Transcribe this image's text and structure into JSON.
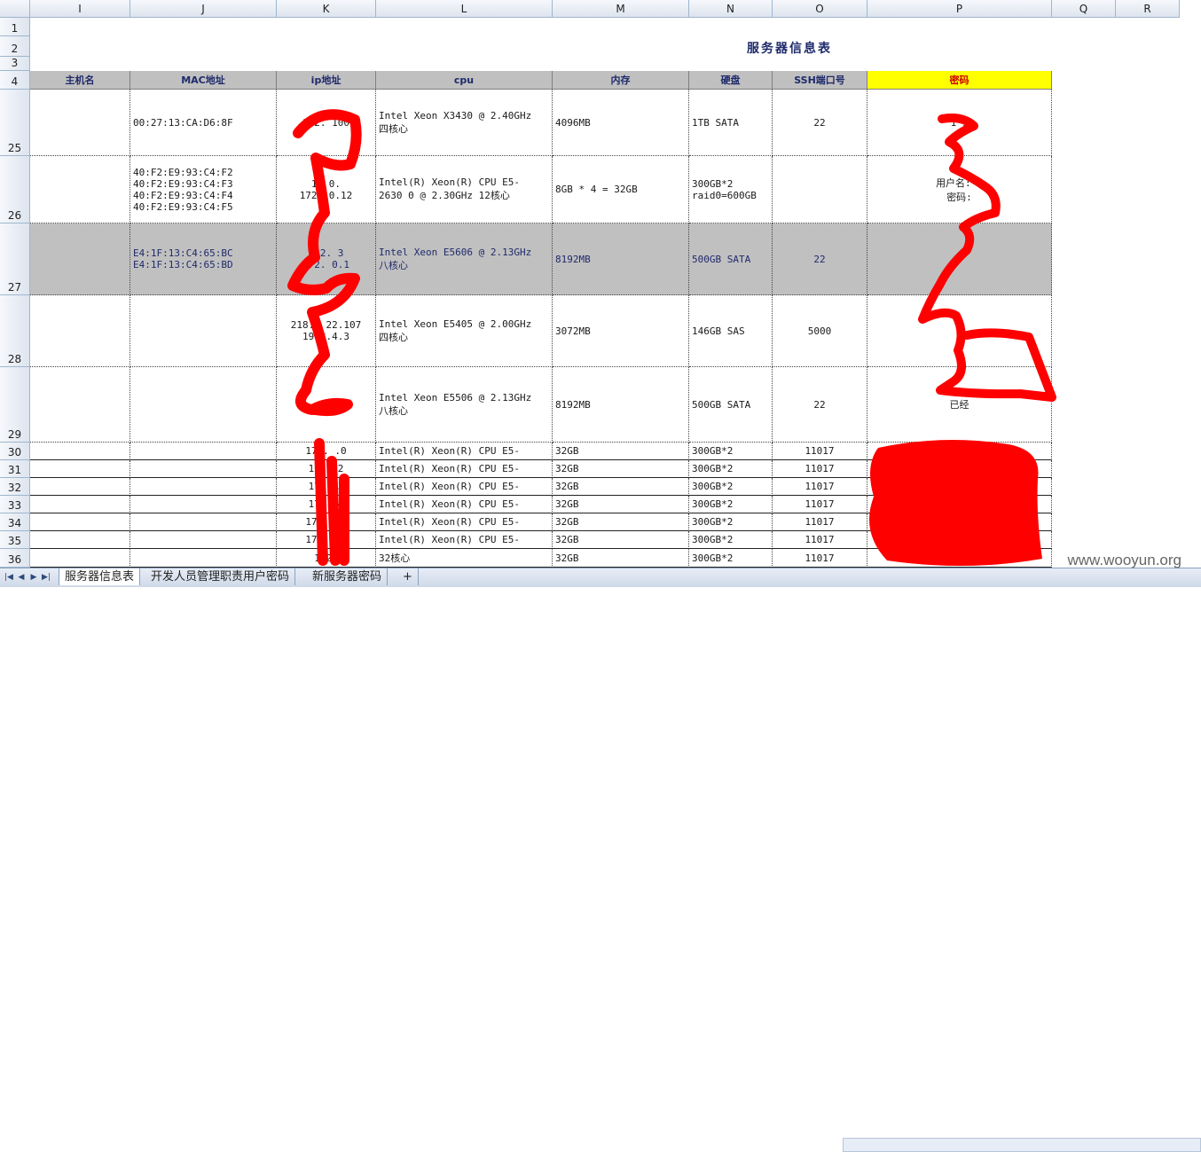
{
  "columns": [
    "I",
    "J",
    "K",
    "L",
    "M",
    "N",
    "O",
    "P",
    "Q",
    "R"
  ],
  "rows": [
    "1",
    "2",
    "3",
    "4",
    "25",
    "26",
    "27",
    "28",
    "29",
    "30",
    "31",
    "32",
    "33",
    "34",
    "35",
    "36"
  ],
  "title": "服务器信息表",
  "headers": [
    "主机名",
    "MAC地址",
    "ip地址",
    "cpu",
    "内存",
    "硬盘",
    "SSH端口号",
    "密码"
  ],
  "data_rows": [
    {
      "host": "",
      "mac": "00:27:13:CA:D6:8F",
      "ip": "172.    100",
      "cpu": "Intel Xeon X3430 @ 2.40GHz\n四核心",
      "mem": "4096MB",
      "disk": "1TB SATA",
      "ssh": "22",
      "pwd": "1      1"
    },
    {
      "host": "",
      "mac": "40:F2:E9:93:C4:F2\n40:F2:E9:93:C4:F3\n40:F2:E9:93:C4:F4\n40:F2:E9:93:C4:F5",
      "ip": "17    0.\n172.    0.12",
      "cpu": "Intel(R) Xeon(R) CPU E5-\n2630 0 @ 2.30GHz 12核心",
      "mem": "8GB * 4 = 32GB",
      "disk": "300GB*2\nraid0=600GB",
      "ssh": "",
      "pwd": "用户名:         r\n密码:"
    },
    {
      "host": "",
      "mac": "E4:1F:13:C4:65:BC\nE4:1F:13:C4:65:BD",
      "ip": "112.      3\n172.    0.1",
      "cpu": "Intel Xeon E5606  @ 2.13GHz\n八核心",
      "mem": "8192MB",
      "disk": "500GB SATA",
      "ssh": "22",
      "pwd": ""
    },
    {
      "host": "",
      "mac": "",
      "ip": "218.2    22.107\n19    3.4.3",
      "cpu": "Intel Xeon E5405 @ 2.00GHz\n四核心",
      "mem": "3072MB",
      "disk": "146GB SAS",
      "ssh": "5000",
      "pwd": "1"
    },
    {
      "host": "",
      "mac": "",
      "ip": "      2",
      "cpu": "Intel Xeon E5506  @ 2.13GHz\n八核心",
      "mem": "8192MB",
      "disk": "500GB SATA",
      "ssh": "22",
      "pwd": "已经"
    },
    {
      "host": "",
      "mac": "",
      "ip": "172.    .0",
      "cpu": "Intel(R) Xeon(R) CPU E5-",
      "mem": "32GB",
      "disk": "300GB*2",
      "ssh": "11017",
      "pwd": ""
    },
    {
      "host": "",
      "mac": "",
      "ip": "172.    2",
      "cpu": "Intel(R) Xeon(R) CPU E5-",
      "mem": "32GB",
      "disk": "300GB*2",
      "ssh": "11017",
      "pwd": "))"
    },
    {
      "host": "",
      "mac": "",
      "ip": "172.    3",
      "cpu": "Intel(R) Xeon(R) CPU E5-",
      "mem": "32GB",
      "disk": "300GB*2",
      "ssh": "11017",
      "pwd": ")"
    },
    {
      "host": "",
      "mac": "",
      "ip": "172.    4",
      "cpu": "Intel(R) Xeon(R) CPU E5-",
      "mem": "32GB",
      "disk": "300GB*2",
      "ssh": "11017",
      "pwd": ""
    },
    {
      "host": "",
      "mac": "",
      "ip": "172.    .5",
      "cpu": "Intel(R) Xeon(R) CPU E5-",
      "mem": "32GB",
      "disk": "300GB*2",
      "ssh": "11017",
      "pwd": ""
    },
    {
      "host": "",
      "mac": "",
      "ip": "172.    .6",
      "cpu": "Intel(R) Xeon(R) CPU E5-",
      "mem": "32GB",
      "disk": "300GB*2",
      "ssh": "11017",
      "pwd": ""
    },
    {
      "host": "",
      "mac": "",
      "ip": "172.",
      "cpu": "32核心",
      "mem": "32GB",
      "disk": "300GB*2",
      "ssh": "11017",
      "pwd": ""
    }
  ],
  "tabs": [
    "服务器信息表",
    "开发人员管理职责用户密码",
    "新服务器密码"
  ],
  "watermark": "www.wooyun.org",
  "colors": {
    "header_gray": "#c0c0c0",
    "password_header": "#ffff00",
    "redaction": "#ff0000"
  }
}
